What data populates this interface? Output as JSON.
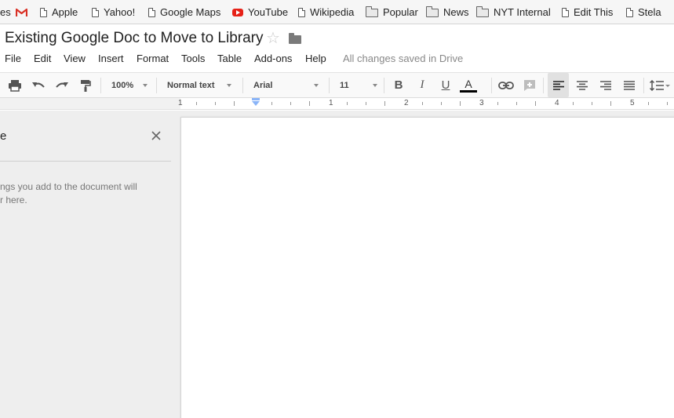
{
  "bookmarks": [
    {
      "label": "es",
      "icon": "none"
    },
    {
      "label": "",
      "icon": "gmail-icon"
    },
    {
      "label": "Apple",
      "icon": "page-icon"
    },
    {
      "label": "Yahoo!",
      "icon": "page-icon"
    },
    {
      "label": "Google Maps",
      "icon": "page-icon"
    },
    {
      "label": "YouTube",
      "icon": "youtube-icon"
    },
    {
      "label": "Wikipedia",
      "icon": "page-icon"
    },
    {
      "label": "Popular",
      "icon": "folder-icon"
    },
    {
      "label": "News",
      "icon": "folder-icon"
    },
    {
      "label": "NYT Internal",
      "icon": "folder-icon"
    },
    {
      "label": "Edit This",
      "icon": "page-icon"
    },
    {
      "label": "Stela",
      "icon": "page-icon"
    }
  ],
  "doc": {
    "title": "Existing Google Doc to Move to Library",
    "star_icon": "star-icon",
    "folder_icon": "folder-icon"
  },
  "menu": {
    "items": [
      "File",
      "Edit",
      "View",
      "Insert",
      "Format",
      "Tools",
      "Table",
      "Add-ons",
      "Help"
    ],
    "save_status": "All changes saved in Drive"
  },
  "toolbar": {
    "zoom": "100%",
    "style": "Normal text",
    "font": "Arial",
    "size": "11",
    "bold": "B",
    "italic": "I",
    "underline": "U",
    "text_color": "A",
    "text_color_value": "#000000",
    "active_alignment": "left"
  },
  "ruler": {
    "labels": [
      "1",
      "1",
      "2",
      "3",
      "4",
      "5"
    ]
  },
  "outline": {
    "title": "e",
    "hint_line1": "ngs you add to the document will",
    "hint_line2": "r here."
  },
  "colors": {
    "gmail_red": "#d93025",
    "youtube_red": "#e62117",
    "indent_blue": "#8ab4f8",
    "canvas_gray": "#eeeeee"
  }
}
